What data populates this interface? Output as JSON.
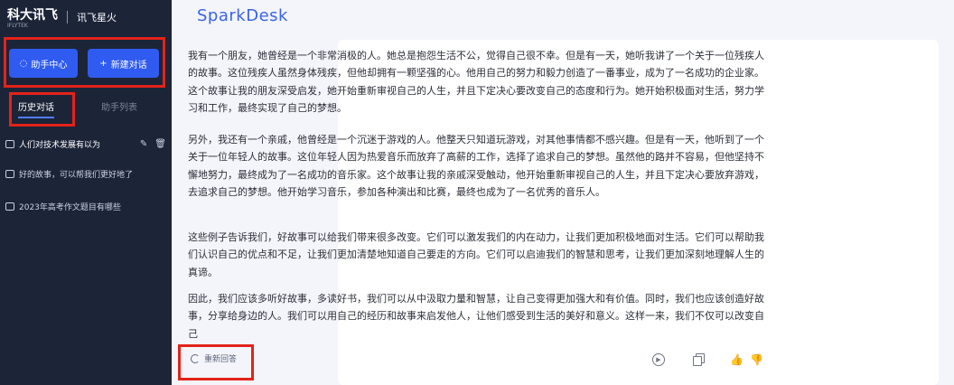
{
  "sidebar": {
    "brand": {
      "logo_text": "科大讯飞",
      "logo_sub": "IFLYTEK",
      "product_text": "讯飞星火"
    },
    "buttons": {
      "help_label": "助手中心",
      "new_chat_label": "新建对话"
    },
    "tabs": {
      "history_label": "历史对话",
      "assistant_list_label": "助手列表"
    },
    "history_items": [
      {
        "label": "人们对技术发展有以为"
      },
      {
        "label": "好的故事，可以帮我们更好地了"
      },
      {
        "label": "2023年高考作文题目有哪些"
      }
    ]
  },
  "main": {
    "app_title": "SparkDesk",
    "answer": {
      "paragraphs": [
        "我有一个朋友，她曾经是一个非常消极的人。她总是抱怨生活不公，觉得自己很不幸。但是有一天，她听我讲了一个关于一位残疾人的故事。这位残疾人虽然身体残疾，但他却拥有一颗坚强的心。他用自己的努力和毅力创造了一番事业，成为了一名成功的企业家。这个故事让我的朋友深受启发，她开始重新审视自己的人生，并且下定决心要改变自己的态度和行为。她开始积极面对生活，努力学习和工作，最终实现了自己的梦想。",
        "另外，我还有一个亲戚，他曾经是一个沉迷于游戏的人。他整天只知道玩游戏，对其他事情都不感兴趣。但是有一天，他听到了一个关于一位年轻人的故事。这位年轻人因为热爱音乐而放弃了高薪的工作，选择了追求自己的梦想。虽然他的路并不容易，但他坚持不懈地努力，最终成为了一名成功的音乐家。这个故事让我的亲戚深受触动，他开始重新审视自己的人生，并且下定决心要放弃游戏，去追求自己的梦想。他开始学习音乐，参加各种演出和比赛，最终也成为了一名优秀的音乐人。",
        "这些例子告诉我们，好故事可以给我们带来很多改变。它们可以激发我们的内在动力，让我们更加积极地面对生活。它们可以帮助我们认识自己的优点和不足，让我们更加清楚地知道自己要走的方向。它们可以启迪我们的智慧和思考，让我们更加深刻地理解人生的真谛。",
        "因此，我们应该多听好故事，多读好书，我们可以从中汲取力量和智慧，让自己变得更加强大和有价值。同时，我们也应该创造好故事，分享给身边的人。我们可以用自己的经历和故事来启发他人，让他们感受到生活的美好和意义。这样一来，我们不仅可以改变自己"
      ],
      "regenerate_label": "重新回答"
    }
  },
  "colors": {
    "sidebar_bg": "#1c2438",
    "accent": "#2f5bf0",
    "highlight_box": "#e2231a"
  },
  "icons": [
    "chat-icon",
    "edit-icon",
    "delete-icon",
    "refresh-icon",
    "play-icon",
    "copy-icon",
    "like-icon",
    "dislike-icon"
  ]
}
